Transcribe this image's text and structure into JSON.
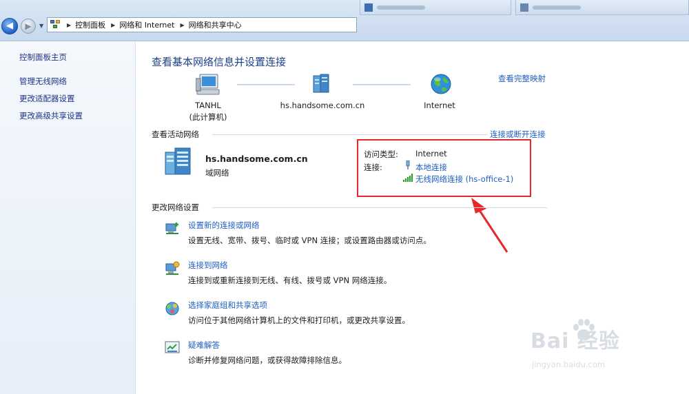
{
  "address_bar": {
    "crumbs": [
      "控制面板",
      "网络和 Internet",
      "网络和共享中心"
    ]
  },
  "left_pane": {
    "links": [
      "控制面板主页",
      "管理无线网络",
      "更改适配器设置",
      "更改高级共享设置"
    ]
  },
  "main": {
    "title": "查看基本网络信息并设置连接",
    "view_full_map": "查看完整映射",
    "map": {
      "computer_name": "TANHL",
      "computer_note": "(此计算机)",
      "domain": "hs.handsome.com.cn",
      "internet": "Internet"
    },
    "active_networks": {
      "heading": "查看活动网络",
      "connect_disconnect": "连接或断开连接",
      "network_name": "hs.handsome.com.cn",
      "network_type": "域网络",
      "access_type_label": "访问类型:",
      "access_type_value": "Internet",
      "connections_label": "连接:",
      "connection_1": "本地连接",
      "connection_2": "无线网络连接 (hs-office-1)"
    },
    "change_settings": {
      "heading": "更改网络设置",
      "tasks": [
        {
          "title": "设置新的连接或网络",
          "desc": "设置无线、宽带、拨号、临时或 VPN 连接；或设置路由器或访问点。"
        },
        {
          "title": "连接到网络",
          "desc": "连接到或重新连接到无线、有线、拨号或 VPN 网络连接。"
        },
        {
          "title": "选择家庭组和共享选项",
          "desc": "访问位于其他网络计算机上的文件和打印机，或更改共享设置。"
        },
        {
          "title": "疑难解答",
          "desc": "诊断并修复网络问题，或获得故障排除信息。"
        }
      ]
    }
  },
  "watermark": {
    "brand": "Bai 经验",
    "url": "jingyan.baidu.com"
  },
  "colors": {
    "link_blue": "#1f5fc2",
    "title_blue": "#1e3f8c",
    "highlight_red": "#e8262b"
  }
}
